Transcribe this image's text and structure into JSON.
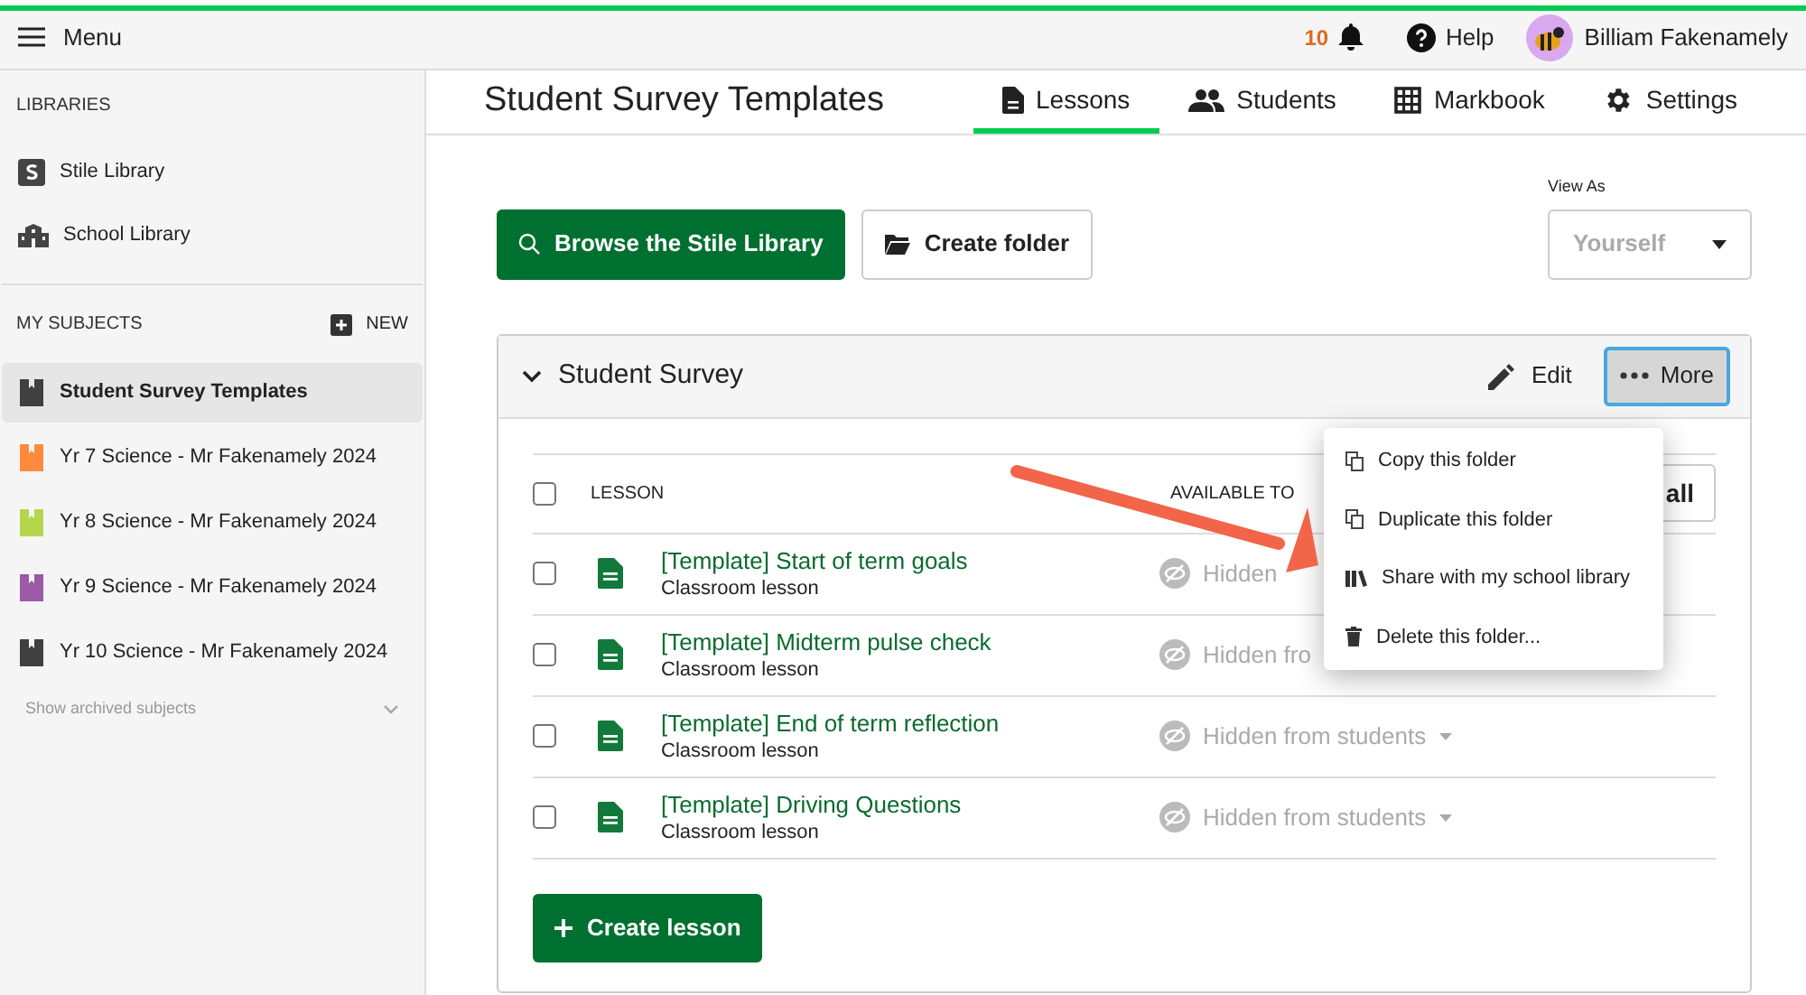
{
  "top_bar": {
    "menu_label": "Menu",
    "notification_count": "10",
    "help_label": "Help",
    "user_name": "Billiam Fakenamely"
  },
  "sidebar": {
    "libraries_heading": "LIBRARIES",
    "libraries": [
      {
        "label": "Stile Library",
        "kind": "stile"
      },
      {
        "label": "School Library",
        "kind": "school"
      }
    ],
    "subjects_heading": "MY SUBJECTS",
    "new_label": "NEW",
    "subjects": [
      {
        "label": "Student Survey Templates",
        "color": "#404040",
        "selected": true
      },
      {
        "label": "Yr 7 Science - Mr Fakenamely 2024",
        "color": "#ff8a3d",
        "selected": false
      },
      {
        "label": "Yr 8 Science - Mr Fakenamely 2024",
        "color": "#b5d64a",
        "selected": false
      },
      {
        "label": "Yr 9 Science - Mr Fakenamely 2024",
        "color": "#9b59a6",
        "selected": false
      },
      {
        "label": "Yr 10 Science - Mr Fakenamely 2024",
        "color": "#404040",
        "selected": false
      }
    ],
    "archived_label": "Show archived subjects"
  },
  "header": {
    "title": "Student Survey Templates",
    "tabs": [
      {
        "label": "Lessons",
        "kind": "doc",
        "selected": true
      },
      {
        "label": "Students",
        "kind": "people",
        "selected": false
      },
      {
        "label": "Markbook",
        "kind": "grid",
        "selected": false
      },
      {
        "label": "Settings",
        "kind": "gear",
        "selected": false
      }
    ]
  },
  "toolbar": {
    "browse_label": "Browse the Stile Library",
    "create_folder_label": "Create folder",
    "view_as_label": "View As",
    "view_as_value": "Yourself"
  },
  "folder": {
    "title": "Student Survey",
    "expanded": true,
    "edit_label": "Edit",
    "more_label": "More",
    "select_all_checked": false,
    "columns": [
      "LESSON",
      "AVAILABLE TO"
    ],
    "header_button": "all",
    "lessons": [
      {
        "title": "[Template] Start of term goals",
        "type": "Classroom lesson",
        "availability": "Hidden",
        "caret": false,
        "checked": false
      },
      {
        "title": "[Template] Midterm pulse check",
        "type": "Classroom lesson",
        "availability": "Hidden fro",
        "caret": false,
        "checked": false
      },
      {
        "title": "[Template] End of term reflection",
        "type": "Classroom lesson",
        "availability": "Hidden from students",
        "caret": true,
        "checked": false
      },
      {
        "title": "[Template] Driving Questions",
        "type": "Classroom lesson",
        "availability": "Hidden from students",
        "caret": true,
        "checked": false
      }
    ],
    "create_lesson_label": "Create lesson"
  },
  "more_menu": {
    "items": [
      {
        "label": "Copy this folder",
        "kind": "copy"
      },
      {
        "label": "Duplicate this folder",
        "kind": "copy"
      },
      {
        "label": "Share with my school library",
        "kind": "books"
      },
      {
        "label": "Delete this folder...",
        "kind": "trash"
      }
    ]
  }
}
